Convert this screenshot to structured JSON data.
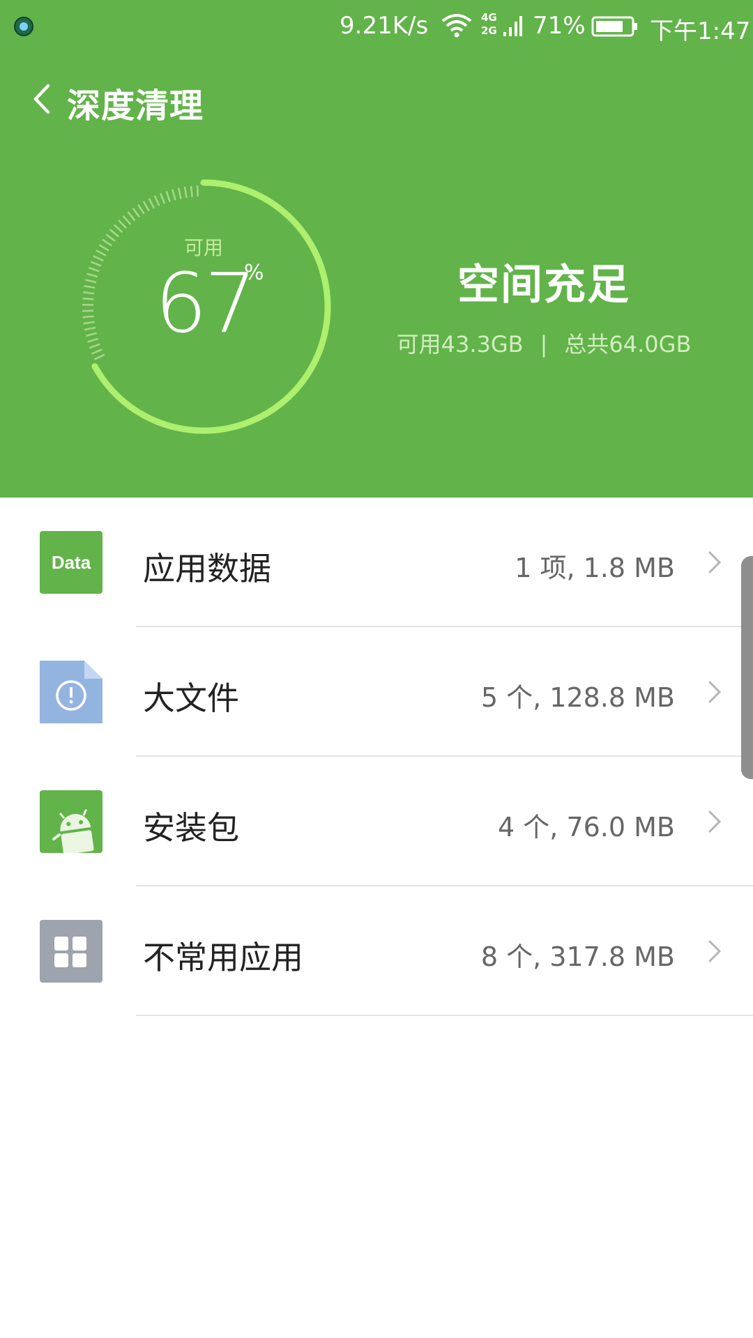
{
  "status_bar": {
    "network_speed": "9.21K/s",
    "network_type_top": "4G",
    "network_type_bottom": "2G",
    "battery_percent": "71%",
    "time": "下午1:47"
  },
  "header": {
    "title": "深度清理",
    "background_color": "#62b34a"
  },
  "gauge": {
    "label": "可用",
    "value": "67",
    "unit": "%",
    "fraction": 0.67,
    "arc_color": "#adf06e"
  },
  "space": {
    "status": "空间充足",
    "available": "可用43.3GB",
    "separator": "|",
    "total": "总共64.0GB"
  },
  "items": [
    {
      "label": "应用数据",
      "value": "1 项, 1.8 MB",
      "icon": "data-icon",
      "icon_text": "Data",
      "color": "#62b34a"
    },
    {
      "label": "大文件",
      "value": "5 个, 128.8 MB",
      "icon": "large-file-icon",
      "color": "#94b4e0"
    },
    {
      "label": "安装包",
      "value": "4 个, 76.0 MB",
      "icon": "android-package-icon",
      "color": "#62b34a"
    },
    {
      "label": "不常用应用",
      "value": "8 个, 317.8 MB",
      "icon": "unused-apps-icon",
      "color": "#9ea3ad"
    }
  ]
}
